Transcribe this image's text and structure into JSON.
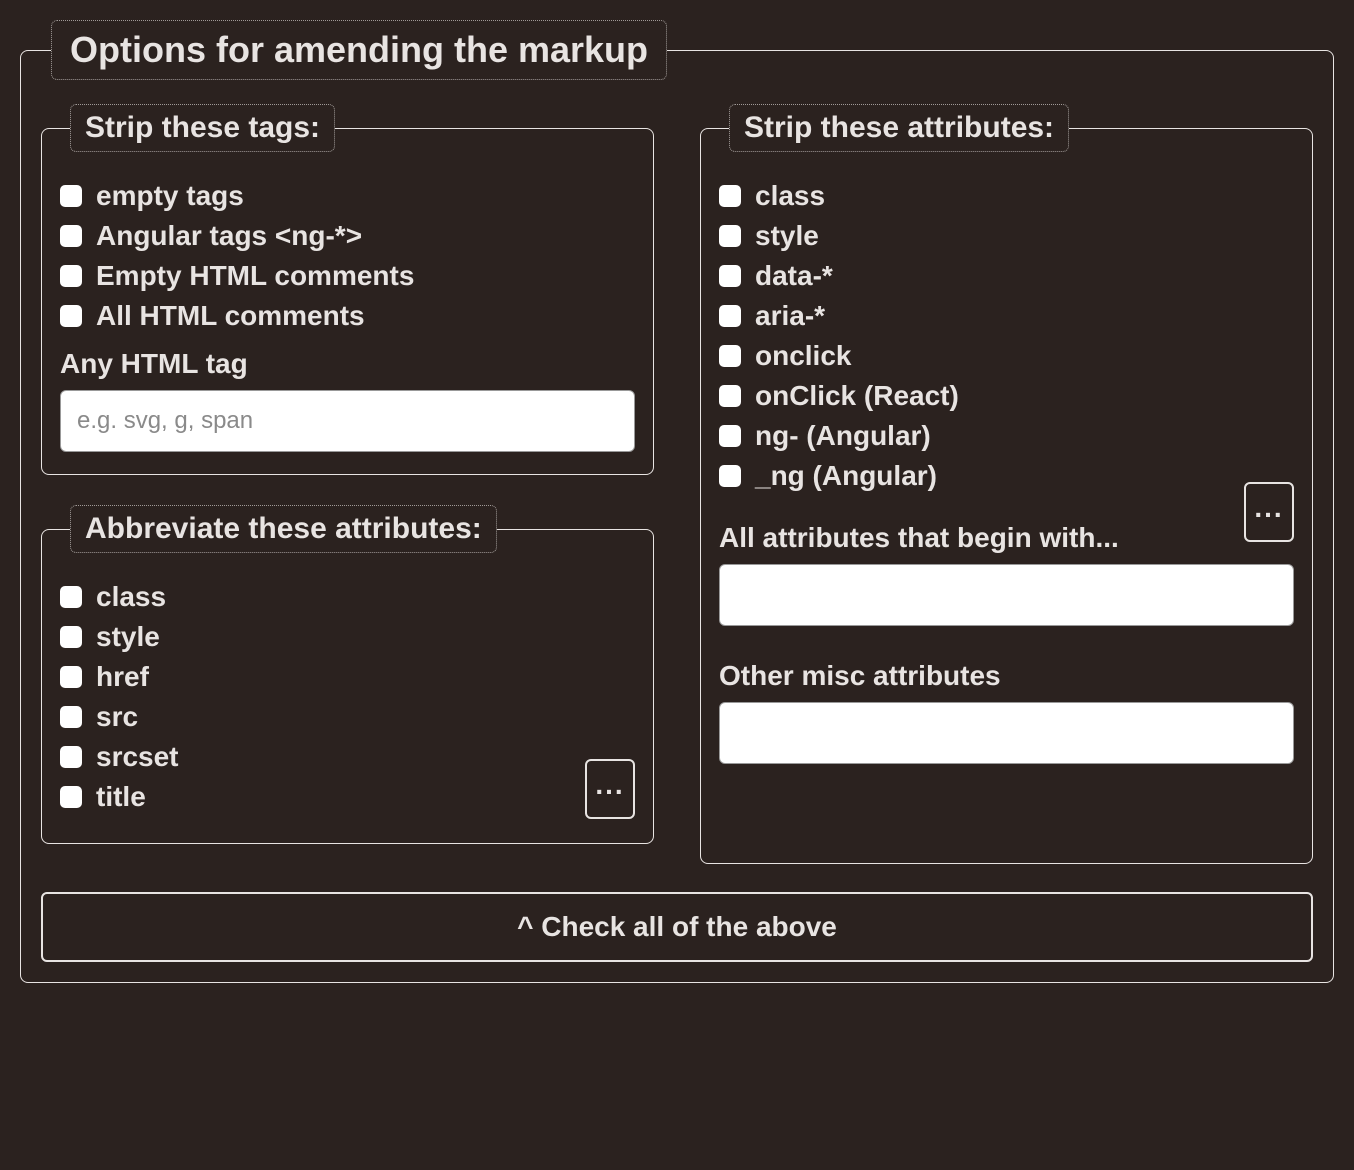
{
  "main": {
    "legend": "Options for amending the markup",
    "check_all_label": "^ Check all of the above"
  },
  "strip_tags": {
    "legend": "Strip these tags:",
    "items": [
      "empty tags",
      "Angular tags <ng-*>",
      "Empty HTML comments",
      "All HTML comments"
    ],
    "any_tag_label": "Any HTML tag",
    "any_tag_placeholder": "e.g. svg, g, span"
  },
  "abbreviate": {
    "legend": "Abbreviate these attributes:",
    "items": [
      "class",
      "style",
      "href",
      "src",
      "srcset",
      "title"
    ],
    "more_label": "..."
  },
  "strip_attrs": {
    "legend": "Strip these attributes:",
    "items": [
      "class",
      "style",
      "data-*",
      "aria-*",
      "onclick",
      "onClick (React)",
      "ng- (Angular)",
      "_ng (Angular)"
    ],
    "more_label": "...",
    "begin_with_label": "All attributes that begin with...",
    "other_misc_label": "Other misc attributes"
  }
}
